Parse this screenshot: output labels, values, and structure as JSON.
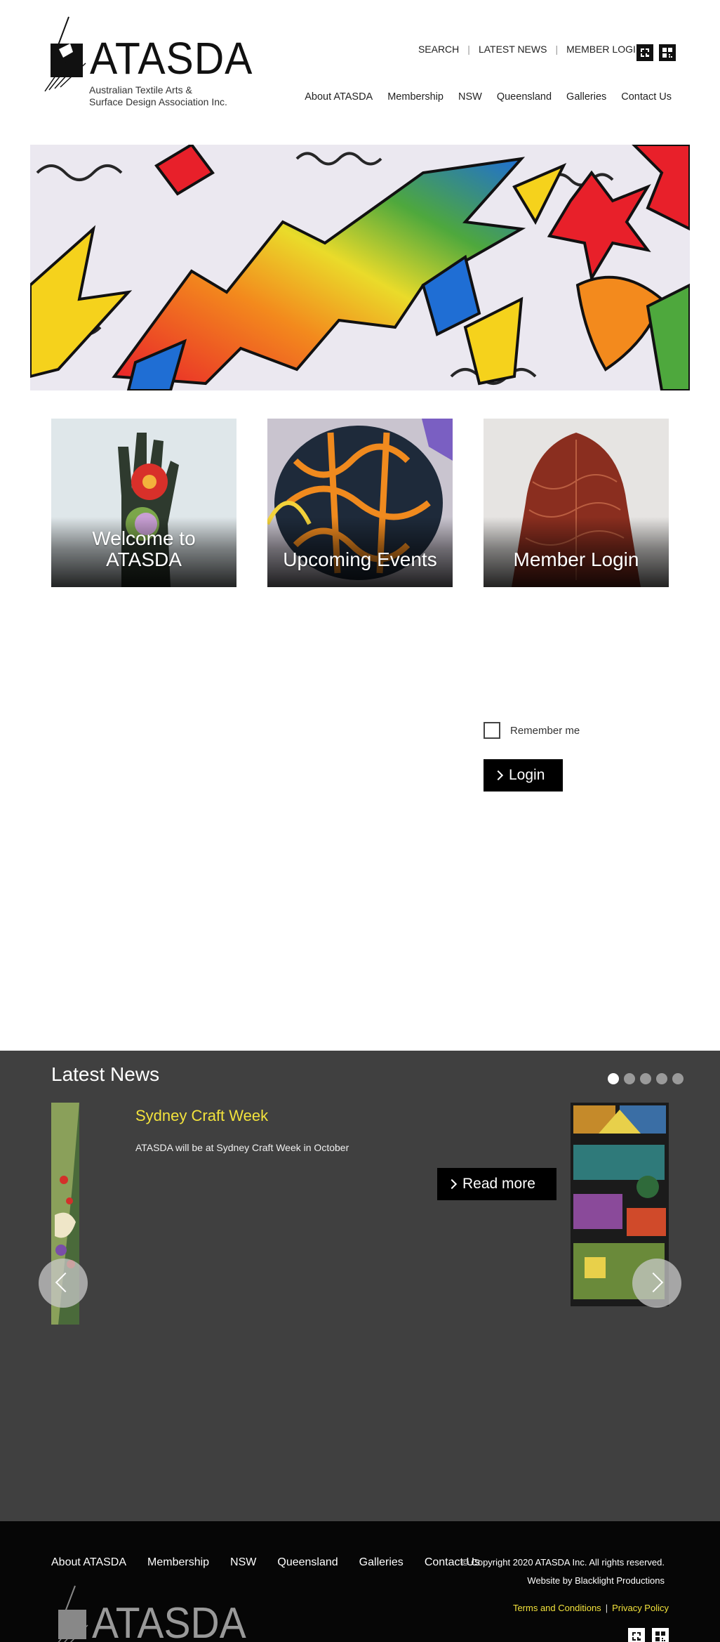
{
  "brand": {
    "name": "ATASDA",
    "tagline_line1": "Australian Textile Arts &",
    "tagline_line2": "Surface Design Association Inc."
  },
  "utility_nav": {
    "search": "SEARCH",
    "latest_news": "LATEST NEWS",
    "member_login": "MEMBER LOGIN"
  },
  "main_nav": [
    "About ATASDA",
    "Membership",
    "NSW",
    "Queensland",
    "Galleries",
    "Contact Us"
  ],
  "tiles": [
    {
      "label": "Welcome to ATASDA"
    },
    {
      "label": "Upcoming Events"
    },
    {
      "label": "Member Login"
    }
  ],
  "login": {
    "remember_label": "Remember me",
    "button_label": "Login",
    "remember_checked": false
  },
  "news": {
    "title": "Latest News",
    "slide_count": 5,
    "active_slide": 1,
    "item_heading": "Sydney Craft Week",
    "item_text": "ATASDA will be at Sydney Craft Week in October",
    "read_more": "Read more"
  },
  "footer": {
    "nav": [
      "About ATASDA",
      "Membership",
      "NSW",
      "Queensland",
      "Galleries",
      "Contact Us"
    ],
    "copyright": "© Copyright 2020 ATASDA Inc. All rights reserved.",
    "credit": "Website by Blacklight Productions",
    "terms": "Terms and Conditions",
    "privacy": "Privacy Policy"
  },
  "colors": {
    "news_bg": "#404040",
    "footer_bg": "#060606",
    "accent_yellow": "#f2e23c",
    "button_bg": "#000000"
  }
}
